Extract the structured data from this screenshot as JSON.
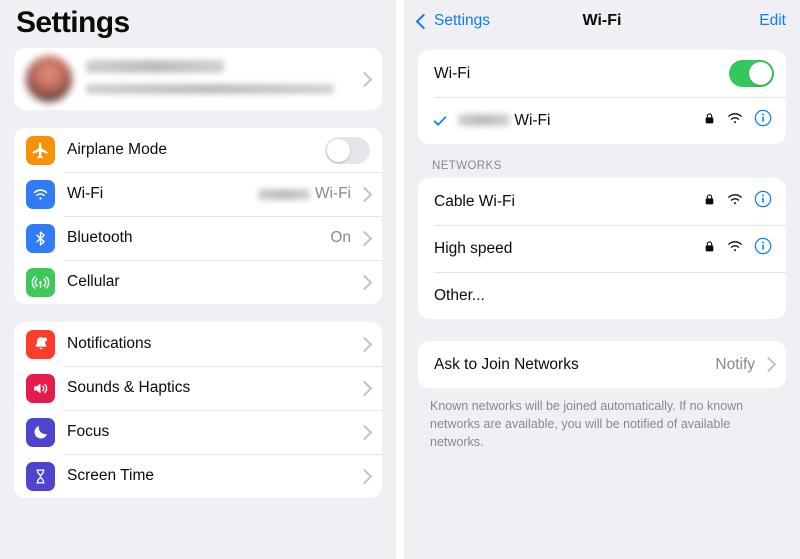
{
  "left": {
    "title": "Settings",
    "profile": {
      "name_redacted": true,
      "subtitle_redacted": true,
      "chevron": "chevron-right"
    },
    "group1": [
      {
        "label": "Airplane Mode",
        "icon": "airplane-icon",
        "icon_color": "#f5920b",
        "control": "toggle",
        "toggle_on": false
      },
      {
        "label": "Wi-Fi",
        "icon": "wifi-icon",
        "icon_color": "#2f7cf6",
        "value": "Wi-Fi",
        "value_redacted": true,
        "control": "chevron"
      },
      {
        "label": "Bluetooth",
        "icon": "bluetooth-icon",
        "icon_color": "#2f7cf6",
        "value": "On",
        "control": "chevron"
      },
      {
        "label": "Cellular",
        "icon": "cellular-icon",
        "icon_color": "#3fc85a",
        "value": "",
        "control": "chevron"
      }
    ],
    "group2": [
      {
        "label": "Notifications",
        "icon": "bell-icon",
        "icon_color": "#fc3c2d",
        "control": "chevron"
      },
      {
        "label": "Sounds & Haptics",
        "icon": "speaker-icon",
        "icon_color": "#e51b4b",
        "control": "chevron"
      },
      {
        "label": "Focus",
        "icon": "moon-icon",
        "icon_color": "#4f44cf",
        "control": "chevron"
      },
      {
        "label": "Screen Time",
        "icon": "hourglass-icon",
        "icon_color": "#4f44cf",
        "control": "chevron"
      }
    ]
  },
  "right": {
    "nav": {
      "back_label": "Settings",
      "title": "Wi-Fi",
      "edit_label": "Edit"
    },
    "wifi_toggle_row": {
      "label": "Wi-Fi",
      "toggle_on": true
    },
    "connected": {
      "name_suffix": "Wi-Fi",
      "name_redacted": true,
      "checked": true,
      "secured": true,
      "signal": "wifi-icon",
      "info": "info-icon"
    },
    "networks_header": "NETWORKS",
    "networks": [
      {
        "label": "Cable Wi-Fi",
        "secured": true,
        "signal": true,
        "info": true
      },
      {
        "label": "High speed",
        "secured": true,
        "signal": true,
        "info": true
      },
      {
        "label": "Other...",
        "secured": false,
        "signal": false,
        "info": false
      }
    ],
    "ask_to_join": {
      "label": "Ask to Join Networks",
      "value": "Notify"
    },
    "footer": "Known networks will be joined automatically. If no known networks are available, you will be notified of available networks."
  },
  "colors": {
    "accent_blue": "#0a7cf6",
    "toggle_green": "#34c759",
    "page_bg": "#efeff4",
    "card_bg": "#ffffff"
  }
}
